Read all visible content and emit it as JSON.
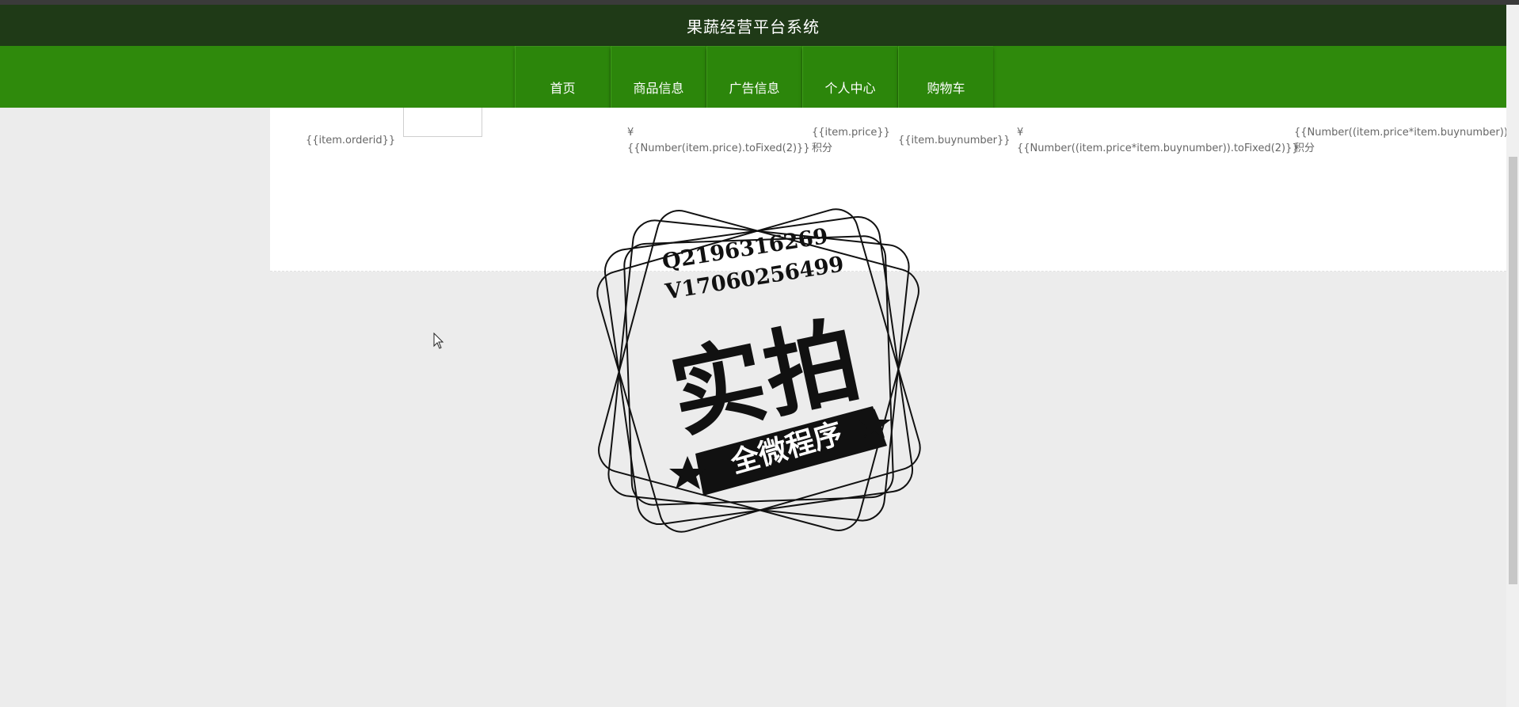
{
  "header": {
    "title": "果蔬经营平台系统"
  },
  "nav": {
    "items": [
      {
        "label": "首页"
      },
      {
        "label": "商品信息"
      },
      {
        "label": "广告信息"
      },
      {
        "label": "个人中心"
      },
      {
        "label": "购物车"
      }
    ]
  },
  "order_row": {
    "orderid": "{{item.orderid}}",
    "price_symbol": "¥",
    "price": "{{Number(item.price).toFixed(2)}}",
    "points_price": "{{item.price}}",
    "points_unit": "积分",
    "buynumber": "{{item.buynumber}}",
    "total_symbol": "¥",
    "total": "{{Number((item.price*item.buynumber)).toFixed(2)}}",
    "points_total": "{{Number((item.price*item.buynumber)).toF",
    "points_total_unit": "积分"
  },
  "watermark": {
    "line1": "Q2196316269",
    "line2": "V17060256499",
    "main": "实拍",
    "ribbon": "全微程序"
  },
  "colors": {
    "titlebar": "#1f3a17",
    "navbar": "#2f8a0c",
    "page_bg": "#ececec"
  }
}
